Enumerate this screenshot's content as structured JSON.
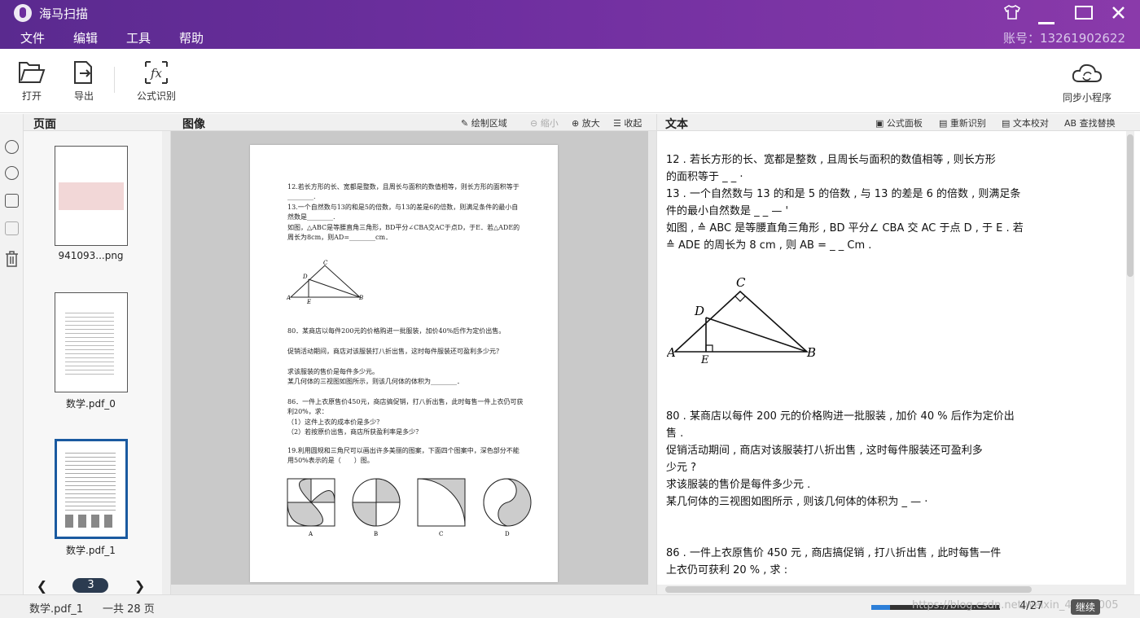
{
  "app": {
    "title": "海马扫描",
    "account": "账号：13261902622"
  },
  "menu": [
    "文件",
    "编辑",
    "工具",
    "帮助"
  ],
  "toolbar": {
    "open": "打开",
    "export": "导出",
    "formula": "公式识别",
    "sync": "同步小程序"
  },
  "pages_panel": {
    "title": "页面",
    "thumbs": [
      {
        "label": "941093...png"
      },
      {
        "label": "数学.pdf_0"
      },
      {
        "label": "数学.pdf_1"
      }
    ],
    "current_page": "3"
  },
  "image_panel": {
    "title": "图像",
    "draw_area": "绘制区域",
    "zoom_out": "缩小",
    "zoom_in": "放大",
    "collapse": "收起"
  },
  "text_panel": {
    "title": "文本",
    "formula_panel": "公式面板",
    "re_recognize": "重新识别",
    "proofread": "文本校对",
    "find_replace": "查找替换"
  },
  "doc": {
    "q12": "12.若长方形的长、宽都是整数，且周长与面积的数值相等，则长方形的面积等于________.",
    "q13": "13.一个自然数与13的和是5的倍数，与13的差是6的倍数，则满足条件的最小自然数是________.",
    "q13b": "如图，△ABC是等腰直角三角形，BD平分∠CBA交AC于点D，于E．若△ADE的周长为8cm，则AD=________cm．",
    "q80": "80．某商店以每件200元的价格购进一批服装，加价40%后作为定价出售。",
    "q80b": "促销活动期间，商店对该服装打八折出售，这时每件服装还可盈利多少元？",
    "q80c": "求该服装的售价是每件多少元。",
    "q80d": "某几何体的三视图如图所示，则该几何体的体积为________．",
    "q86": "86．一件上衣原售价450元，商店搞促销，打八折出售，此时每售一件上衣仍可获利20%，求：",
    "q86a": "（1）这件上衣的成本价是多少？",
    "q86b": "（2）若按原价出售，商店所获盈利率是多少？",
    "q19": "19.利用圆规和三角尺可以画出许多美丽的图案，下面四个图案中，深色部分不能用50%表示的是（　　）图。",
    "figs": [
      "A",
      "B",
      "C",
      "D"
    ]
  },
  "text": {
    "l1": "12 . 若长方形的长、宽都是整数 , 且周长与面积的数值相等 , 则长方形",
    "l2": "的面积等于 _ _ ·",
    "l3": "13 . 一个自然数与 13 的和是 5 的倍数 , 与 13 的差是 6 的倍数 , 则满足条",
    "l4": "件的最小自然数是 _ _ — '",
    "l5": "如图 , ≙ ABC 是等腰直角三角形 , BD 平分∠ CBA 交 AC 于点 D , 于 E . 若",
    "l6": "≙ ADE 的周长为 8 cm , 则 AB = _ _ Cm .",
    "l7": "80 . 某商店以每件 200 元的价格购进一批服装 , 加价 40 % 后作为定价出",
    "l8": "售 .",
    "l9": "促销活动期间 , 商店对该服装打八折出售 , 这时每件服装还可盈利多",
    "l10": "少元 ?",
    "l11": "求该服装的售价是每件多少元 .",
    "l12": "某几何体的三视图如图所示 , 则该几何体的体积为 _ — ·",
    "l13": "86 . 一件上衣原售价 450 元 , 商店搞促销 , 打八折出售 , 此时每售一件",
    "l14": "上衣仍可获利 20 % , 求 :"
  },
  "triangle_labels": {
    "a": "A",
    "b": "B",
    "c": "C",
    "d": "D",
    "e": "E"
  },
  "status": {
    "file": "数学.pdf_1",
    "total": "一共 28 页",
    "progress": "4/27",
    "continue": "继续",
    "progress_fraction": 0.148,
    "watermark": "https://blog.csdn.net/weixin_40836005"
  }
}
